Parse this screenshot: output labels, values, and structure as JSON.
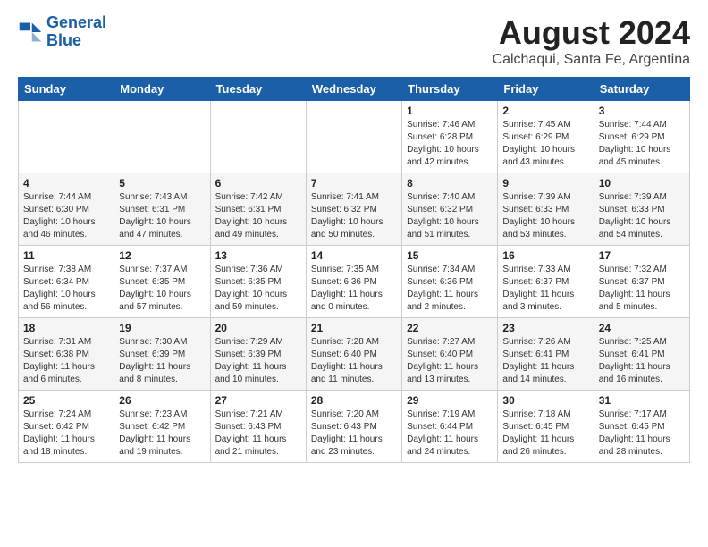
{
  "header": {
    "logo_line1": "General",
    "logo_line2": "Blue",
    "main_title": "August 2024",
    "sub_title": "Calchaqui, Santa Fe, Argentina"
  },
  "columns": [
    "Sunday",
    "Monday",
    "Tuesday",
    "Wednesday",
    "Thursday",
    "Friday",
    "Saturday"
  ],
  "weeks": [
    [
      {
        "day": "",
        "info": ""
      },
      {
        "day": "",
        "info": ""
      },
      {
        "day": "",
        "info": ""
      },
      {
        "day": "",
        "info": ""
      },
      {
        "day": "1",
        "info": "Sunrise: 7:46 AM\nSunset: 6:28 PM\nDaylight: 10 hours\nand 42 minutes."
      },
      {
        "day": "2",
        "info": "Sunrise: 7:45 AM\nSunset: 6:29 PM\nDaylight: 10 hours\nand 43 minutes."
      },
      {
        "day": "3",
        "info": "Sunrise: 7:44 AM\nSunset: 6:29 PM\nDaylight: 10 hours\nand 45 minutes."
      }
    ],
    [
      {
        "day": "4",
        "info": "Sunrise: 7:44 AM\nSunset: 6:30 PM\nDaylight: 10 hours\nand 46 minutes."
      },
      {
        "day": "5",
        "info": "Sunrise: 7:43 AM\nSunset: 6:31 PM\nDaylight: 10 hours\nand 47 minutes."
      },
      {
        "day": "6",
        "info": "Sunrise: 7:42 AM\nSunset: 6:31 PM\nDaylight: 10 hours\nand 49 minutes."
      },
      {
        "day": "7",
        "info": "Sunrise: 7:41 AM\nSunset: 6:32 PM\nDaylight: 10 hours\nand 50 minutes."
      },
      {
        "day": "8",
        "info": "Sunrise: 7:40 AM\nSunset: 6:32 PM\nDaylight: 10 hours\nand 51 minutes."
      },
      {
        "day": "9",
        "info": "Sunrise: 7:39 AM\nSunset: 6:33 PM\nDaylight: 10 hours\nand 53 minutes."
      },
      {
        "day": "10",
        "info": "Sunrise: 7:39 AM\nSunset: 6:33 PM\nDaylight: 10 hours\nand 54 minutes."
      }
    ],
    [
      {
        "day": "11",
        "info": "Sunrise: 7:38 AM\nSunset: 6:34 PM\nDaylight: 10 hours\nand 56 minutes."
      },
      {
        "day": "12",
        "info": "Sunrise: 7:37 AM\nSunset: 6:35 PM\nDaylight: 10 hours\nand 57 minutes."
      },
      {
        "day": "13",
        "info": "Sunrise: 7:36 AM\nSunset: 6:35 PM\nDaylight: 10 hours\nand 59 minutes."
      },
      {
        "day": "14",
        "info": "Sunrise: 7:35 AM\nSunset: 6:36 PM\nDaylight: 11 hours\nand 0 minutes."
      },
      {
        "day": "15",
        "info": "Sunrise: 7:34 AM\nSunset: 6:36 PM\nDaylight: 11 hours\nand 2 minutes."
      },
      {
        "day": "16",
        "info": "Sunrise: 7:33 AM\nSunset: 6:37 PM\nDaylight: 11 hours\nand 3 minutes."
      },
      {
        "day": "17",
        "info": "Sunrise: 7:32 AM\nSunset: 6:37 PM\nDaylight: 11 hours\nand 5 minutes."
      }
    ],
    [
      {
        "day": "18",
        "info": "Sunrise: 7:31 AM\nSunset: 6:38 PM\nDaylight: 11 hours\nand 6 minutes."
      },
      {
        "day": "19",
        "info": "Sunrise: 7:30 AM\nSunset: 6:39 PM\nDaylight: 11 hours\nand 8 minutes."
      },
      {
        "day": "20",
        "info": "Sunrise: 7:29 AM\nSunset: 6:39 PM\nDaylight: 11 hours\nand 10 minutes."
      },
      {
        "day": "21",
        "info": "Sunrise: 7:28 AM\nSunset: 6:40 PM\nDaylight: 11 hours\nand 11 minutes."
      },
      {
        "day": "22",
        "info": "Sunrise: 7:27 AM\nSunset: 6:40 PM\nDaylight: 11 hours\nand 13 minutes."
      },
      {
        "day": "23",
        "info": "Sunrise: 7:26 AM\nSunset: 6:41 PM\nDaylight: 11 hours\nand 14 minutes."
      },
      {
        "day": "24",
        "info": "Sunrise: 7:25 AM\nSunset: 6:41 PM\nDaylight: 11 hours\nand 16 minutes."
      }
    ],
    [
      {
        "day": "25",
        "info": "Sunrise: 7:24 AM\nSunset: 6:42 PM\nDaylight: 11 hours\nand 18 minutes."
      },
      {
        "day": "26",
        "info": "Sunrise: 7:23 AM\nSunset: 6:42 PM\nDaylight: 11 hours\nand 19 minutes."
      },
      {
        "day": "27",
        "info": "Sunrise: 7:21 AM\nSunset: 6:43 PM\nDaylight: 11 hours\nand 21 minutes."
      },
      {
        "day": "28",
        "info": "Sunrise: 7:20 AM\nSunset: 6:43 PM\nDaylight: 11 hours\nand 23 minutes."
      },
      {
        "day": "29",
        "info": "Sunrise: 7:19 AM\nSunset: 6:44 PM\nDaylight: 11 hours\nand 24 minutes."
      },
      {
        "day": "30",
        "info": "Sunrise: 7:18 AM\nSunset: 6:45 PM\nDaylight: 11 hours\nand 26 minutes."
      },
      {
        "day": "31",
        "info": "Sunrise: 7:17 AM\nSunset: 6:45 PM\nDaylight: 11 hours\nand 28 minutes."
      }
    ]
  ]
}
